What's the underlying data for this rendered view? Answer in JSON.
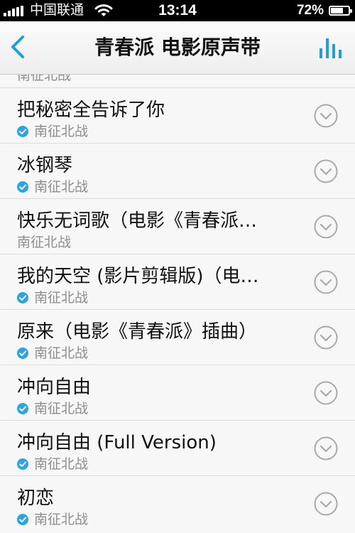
{
  "status_bar": {
    "carrier": "中国联通",
    "time": "13:14",
    "battery_text": "72%",
    "battery_level": 0.72
  },
  "nav": {
    "title": "青春派 电影原声带",
    "back_icon": "chevron-left-icon",
    "equalizer_icon": "equalizer-icon"
  },
  "accent_color": "#2aa4e8",
  "partial_row": {
    "artist": "南征北战"
  },
  "songs": [
    {
      "title": "把秘密全告诉了你",
      "artist": "南征北战",
      "verified": true
    },
    {
      "title": "冰钢琴",
      "artist": "南征北战",
      "verified": true
    },
    {
      "title": "快乐无词歌（电影《青春派…",
      "artist": "南征北战",
      "verified": false
    },
    {
      "title": "我的天空 (影片剪辑版)（电…",
      "artist": "南征北战",
      "verified": true
    },
    {
      "title": "原来（电影《青春派》插曲）",
      "artist": "南征北战",
      "verified": true
    },
    {
      "title": "冲向自由",
      "artist": "南征北战",
      "verified": true
    },
    {
      "title": "冲向自由  (Full  Version)",
      "artist": "南征北战",
      "verified": true
    },
    {
      "title": "初恋",
      "artist": "南征北战",
      "verified": true
    }
  ]
}
